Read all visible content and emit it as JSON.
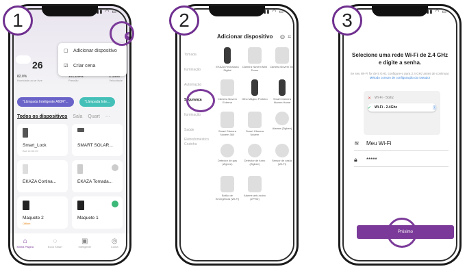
{
  "steps": [
    "1",
    "2",
    "3"
  ],
  "phone1": {
    "weather_temp": "26",
    "stats": [
      {
        "value": "82.0%",
        "label": "Humidade ao ar livre"
      },
      {
        "value": "101.2hPa",
        "label": "Pressão"
      },
      {
        "value": "2.1m/s",
        "label": "Velocidade"
      }
    ],
    "menu": [
      {
        "icon": "▢",
        "label": "Adicionar dispositivo"
      },
      {
        "icon": "☑",
        "label": "Criar cena"
      }
    ],
    "scenes": [
      "\"Lâmpada Inteligente A60R\"...",
      "\"Lâmpada Inte..."
    ],
    "tabs": [
      "Todos os dispositivos",
      "Sala",
      "Quart"
    ],
    "devices": [
      {
        "name": "Smart_Lock",
        "sub": "Bat 14:30:20"
      },
      {
        "name": "SMART SOLAR...",
        "sub": ""
      },
      {
        "name": "EKAZA Cortina...",
        "sub": ""
      },
      {
        "name": "EKAZA Tomada...",
        "sub": ""
      },
      {
        "name": "Maquete 2",
        "sub": "Offline"
      },
      {
        "name": "Maquete 1",
        "sub": ""
      }
    ],
    "nav": [
      {
        "icon": "⌂",
        "label": "Minha Página"
      },
      {
        "icon": "◌",
        "label": "Ecoo Smart"
      },
      {
        "icon": "▣",
        "label": "Inteligente"
      },
      {
        "icon": "◎",
        "label": "Conta"
      }
    ]
  },
  "phone2": {
    "title": "Adicionar dispositivo",
    "categories": [
      "Tomada",
      "Iluminação",
      "Automação",
      "Segurança",
      "Iluminação",
      "Saúde",
      "Eletrodoméstico Cozinha"
    ],
    "devices": [
      {
        "name": "EKAZA Fechadura Digital",
        "kind": "dark"
      },
      {
        "name": "Câmera Nuvem Mini Dome",
        "kind": "normal"
      },
      {
        "name": "Câmera Nuvem 360",
        "kind": "normal"
      },
      {
        "name": "Câmera Nuvem Externa",
        "kind": "normal"
      },
      {
        "name": "Olho Mágico Porteiro",
        "kind": "dark"
      },
      {
        "name": "Smart Câmera Nuvem Home",
        "kind": "dark"
      },
      {
        "name": "Smart Câmera Nuvem 360",
        "kind": "normal"
      },
      {
        "name": "Smart Câmera Nuvem",
        "kind": "normal"
      },
      {
        "name": "Alarme (Zigbee)",
        "kind": "round"
      },
      {
        "name": "Detector de gás (Zigbee)",
        "kind": "round"
      },
      {
        "name": "Detector de fumo (Zigbee)",
        "kind": "round"
      },
      {
        "name": "Sensor de vazão (Wi-Fi)",
        "kind": "round"
      },
      {
        "name": "Botão de Emergência (Wi-Fi)",
        "kind": "normal"
      },
      {
        "name": "Alarme anti-roubo (ZPHD)",
        "kind": "normal"
      }
    ]
  },
  "phone3": {
    "title": "Selecione uma rede Wi-Fi de 2.4 GHz e digite a senha.",
    "subtitle": "Se seu Wi-Fi for de 5 GHz, configure-o para 2.4 GHz antes de continuar.",
    "subtitle_link": "Método comum de configuração do roteador",
    "wifi_options": [
      {
        "mark": "✕",
        "label": "Wi-Fi - 5Ghz",
        "selected": false
      },
      {
        "mark": "✓",
        "label": "Wi-Fi - 2.4Ghz",
        "selected": true
      },
      {
        "mark": "",
        "label": "",
        "selected": false
      },
      {
        "mark": "",
        "label": "",
        "selected": false
      }
    ],
    "network_name": "Meu Wi-Fi",
    "password": "*****",
    "next_label": "Próximo"
  }
}
